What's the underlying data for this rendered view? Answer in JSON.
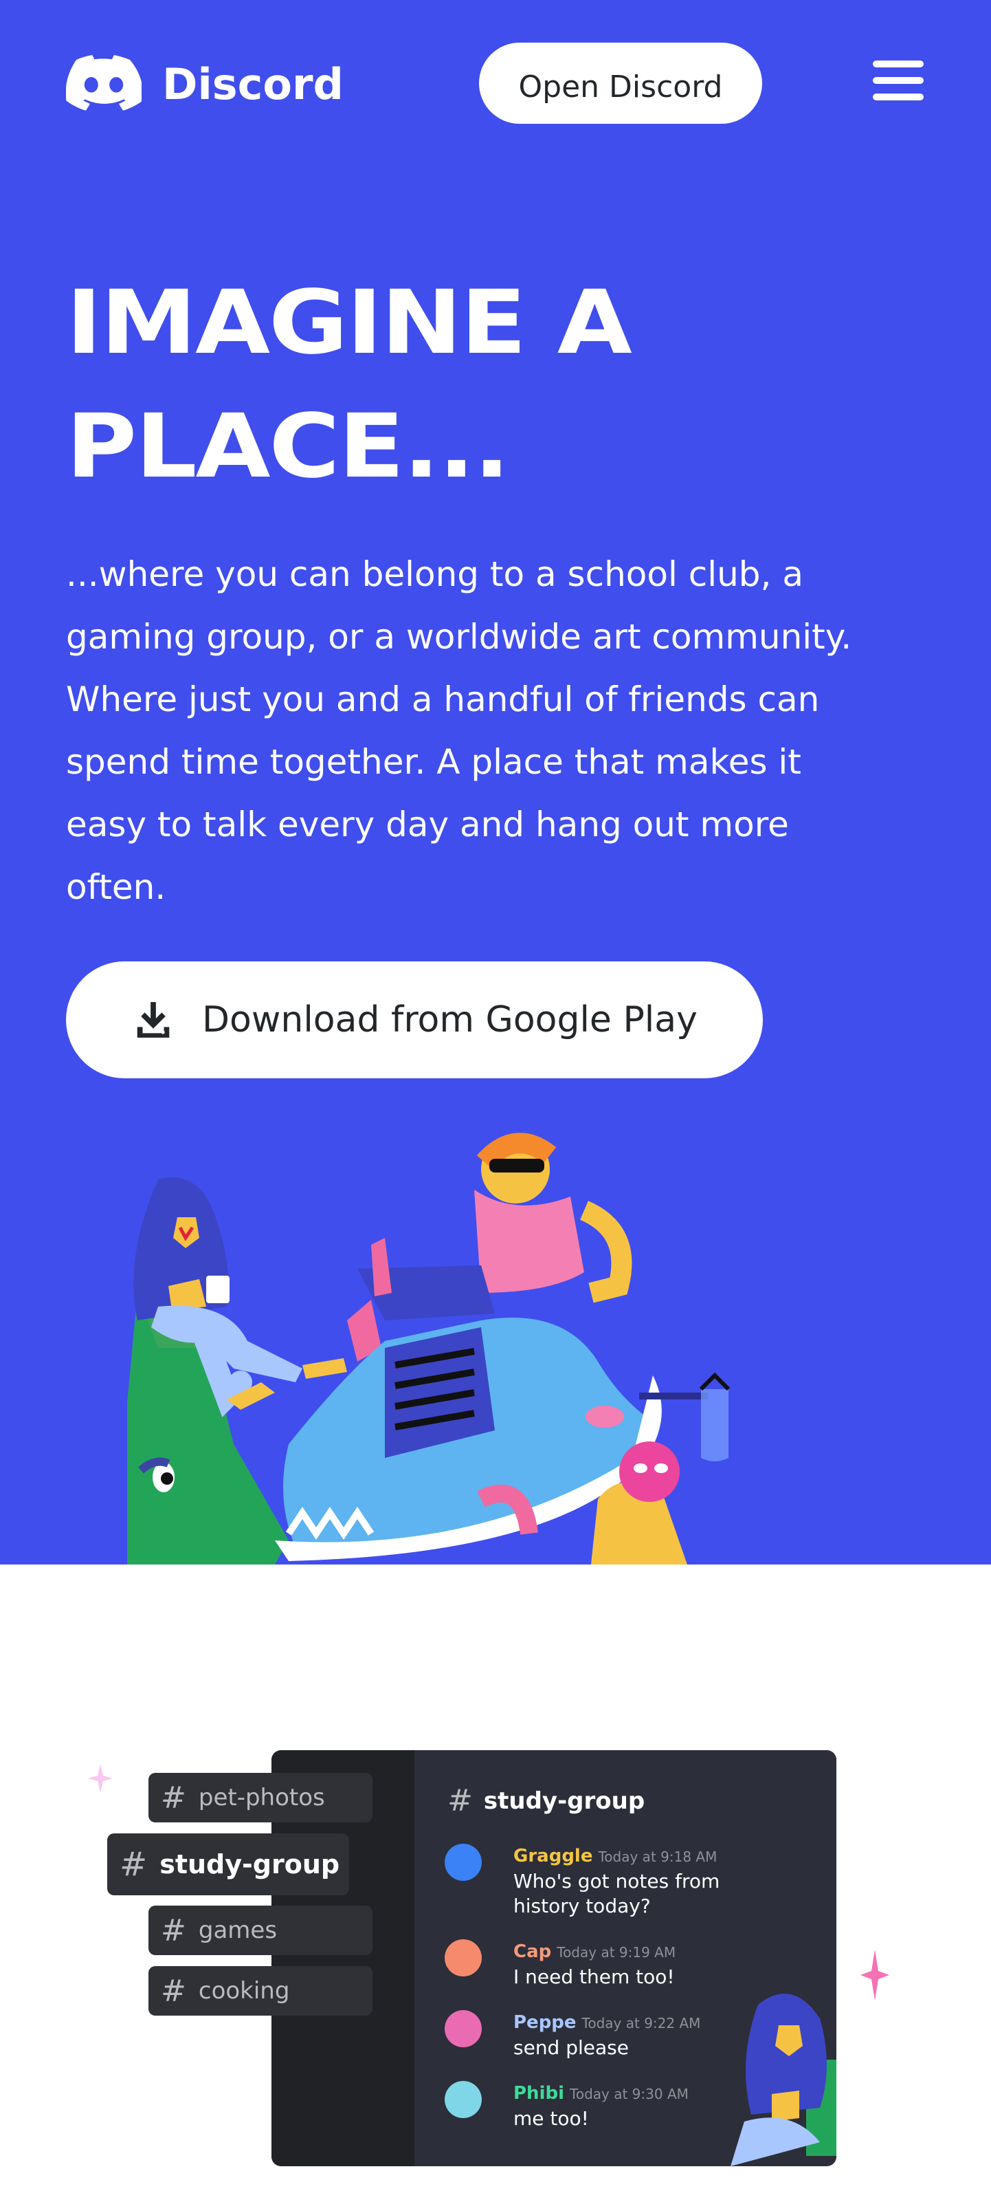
{
  "nav": {
    "brand": "Discord",
    "open_button": "Open Discord"
  },
  "hero": {
    "headline_line1": "IMAGINE A",
    "headline_line2": "PLACE...",
    "subtext": "...where you can belong to a school club, a gaming group, or a worldwide art community. Where just you and a handful of friends can spend time together. A place that makes it easy to talk every day and hang out more often.",
    "download_button": "Download from Google Play"
  },
  "chat_preview": {
    "channels": [
      "pet-photos",
      "study-group",
      "games",
      "cooking"
    ],
    "active_channel": "study-group",
    "header_channel": "study-group",
    "messages": [
      {
        "name": "Graggle",
        "time": "Today at 9:18 AM",
        "text": "Who's got notes from history today?",
        "color": "#f5c542",
        "avatar": "#3b82f6"
      },
      {
        "name": "Cap",
        "time": "Today at 9:19 AM",
        "text": "I need them too!",
        "color": "#f59a7a",
        "avatar": "#f58a6c"
      },
      {
        "name": "Peppe",
        "time": "Today at 9:22 AM",
        "text": "send please",
        "color": "#a8c7ff",
        "avatar": "#eb6bb3"
      },
      {
        "name": "Phibi",
        "time": "Today at 9:30 AM",
        "text": "me too!",
        "color": "#3ddc97",
        "avatar": "#7fd6e6"
      }
    ]
  },
  "colors": {
    "brand_blurple": "#404eed",
    "white": "#ffffff",
    "chat_dark": "#2c2e3a"
  }
}
